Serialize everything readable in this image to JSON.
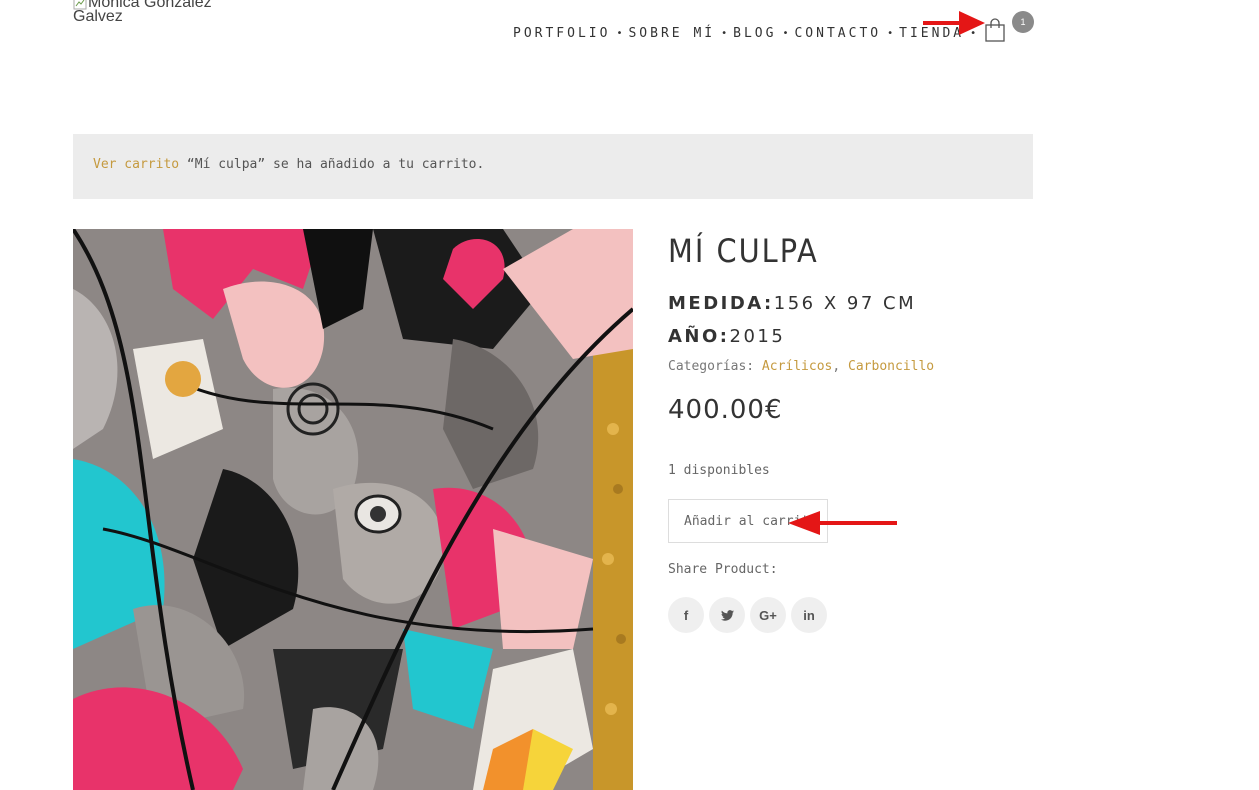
{
  "header": {
    "logo_alt": "Monica Gonzalez Galvez",
    "nav": [
      "PORTFOLIO",
      "SOBRE MÍ",
      "BLOG",
      "CONTACTO",
      "TIENDA"
    ],
    "separator": "•",
    "cart_count": "1"
  },
  "notice": {
    "link": "Ver carrito",
    "message": " “Mí culpa” se ha añadido a tu carrito."
  },
  "product": {
    "title": "MÍ CULPA",
    "measure_label": "MEDIDA:",
    "measure_value": "156 X 97 CM",
    "year_label": "AÑO:",
    "year_value": "2015",
    "categories_label": "Categorías:",
    "categories": [
      "Acrílicos",
      "Carboncillo"
    ],
    "categories_sep": ", ",
    "price": "400.00€",
    "stock": "1 disponibles",
    "add_to_cart": "Añadir al carrito",
    "share_label": "Share Product:"
  },
  "social": {
    "facebook": "f",
    "google_plus": "G+",
    "linkedin": "in"
  },
  "colors": {
    "accent": "#c59a3f",
    "annotation_arrow": "#e41616",
    "notice_bg": "#ececec",
    "badge": "#8a8a8a"
  },
  "icons": [
    "broken-image-icon",
    "shopping-bag-icon",
    "facebook-icon",
    "twitter-icon",
    "google-plus-icon",
    "linkedin-icon",
    "red-arrow-icon"
  ]
}
